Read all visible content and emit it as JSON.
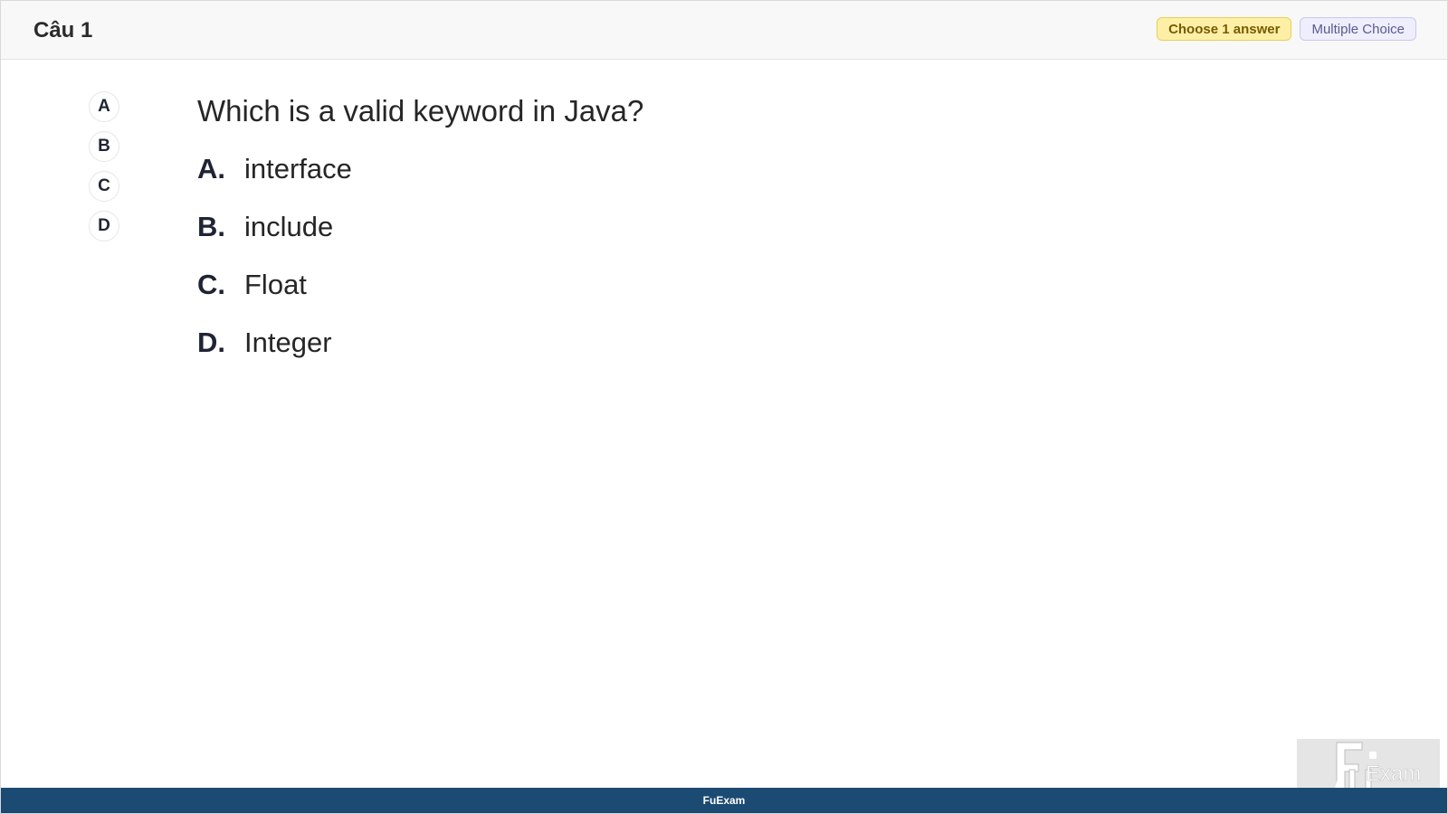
{
  "header": {
    "question_title": "Câu 1",
    "choose_badge": "Choose 1 answer",
    "type_badge": "Multiple Choice"
  },
  "options": [
    "A",
    "B",
    "C",
    "D"
  ],
  "question": {
    "text": "Which is a valid keyword in Java?",
    "answers": [
      {
        "letter": "A.",
        "text": "interface"
      },
      {
        "letter": "B.",
        "text": "include"
      },
      {
        "letter": "C.",
        "text": "Float"
      },
      {
        "letter": "D.",
        "text": "Integer"
      }
    ]
  },
  "footer": {
    "brand": "FuExam"
  },
  "logo": {
    "icon": "fuexam-logo-icon",
    "text": "Exam"
  },
  "colors": {
    "footer_bg": "#1b4a73",
    "choose_badge_bg": "#fdf0a6",
    "type_badge_bg": "#eeeefc"
  }
}
